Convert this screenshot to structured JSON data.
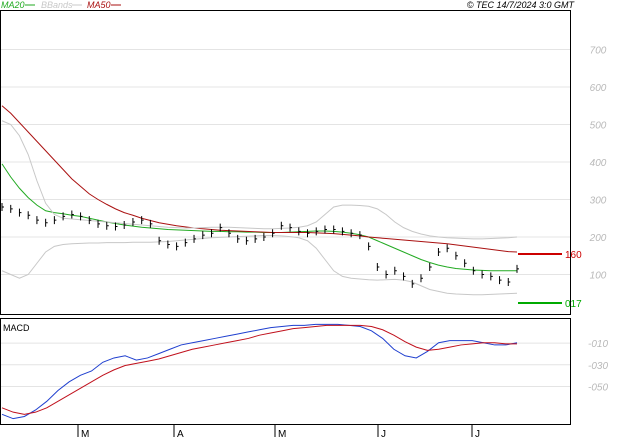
{
  "header": {
    "legend": [
      {
        "label": "MA20",
        "color": "#22aa22"
      },
      {
        "label": "BBands",
        "color": "#c8c8c8"
      },
      {
        "label": "MA50",
        "color": "#aa1111"
      }
    ],
    "copyright": "© TEC 14/7/2024 3:0 GMT"
  },
  "chart_data": [
    {
      "type": "line",
      "panel": "price",
      "title": "",
      "x_ticks": [
        "M",
        "A",
        "M",
        "J",
        "J"
      ],
      "yticks": [
        "700",
        "600",
        "500",
        "400",
        "300",
        "200",
        "100"
      ],
      "ylim": [
        0,
        800
      ],
      "grid": true,
      "y_side": "right",
      "markers": [
        {
          "label": "160",
          "value": 160,
          "color": "#cc0000"
        },
        {
          "label": "017",
          "value": 17,
          "color": "#00aa00"
        }
      ],
      "series": [
        {
          "name": "MA20",
          "color": "#22aa22",
          "values": [
            395,
            360,
            330,
            305,
            285,
            270,
            265,
            262,
            258,
            255,
            250,
            245,
            240,
            236,
            232,
            229,
            226,
            224,
            222,
            220,
            219,
            218,
            217,
            216,
            215,
            215,
            214,
            214,
            213,
            213,
            212,
            212,
            212,
            213,
            214,
            215,
            216,
            216,
            215,
            213,
            210,
            206,
            200,
            190,
            180,
            170,
            160,
            150,
            140,
            132,
            125,
            120,
            116,
            114,
            112,
            111,
            110,
            110,
            110,
            110
          ]
        },
        {
          "name": "MA50",
          "color": "#aa1111",
          "values": [
            550,
            530,
            505,
            480,
            455,
            430,
            405,
            380,
            355,
            335,
            315,
            300,
            287,
            275,
            265,
            258,
            250,
            244,
            238,
            234,
            230,
            227,
            224,
            222,
            220,
            218,
            217,
            216,
            215,
            214,
            213,
            212,
            212,
            212,
            212,
            212,
            211,
            210,
            209,
            207,
            205,
            203,
            200,
            198,
            196,
            194,
            192,
            190,
            188,
            186,
            184,
            182,
            179,
            176,
            173,
            170,
            167,
            164,
            161,
            160
          ]
        },
        {
          "name": "BBands upper",
          "color": "#c8c8c8",
          "values": [
            510,
            500,
            470,
            420,
            350,
            290,
            260,
            250,
            248,
            246,
            244,
            242,
            240,
            238,
            236,
            234,
            232,
            230,
            228,
            226,
            225,
            224,
            224,
            225,
            226,
            226,
            226,
            225,
            224,
            223,
            222,
            222,
            223,
            224,
            226,
            230,
            240,
            260,
            280,
            285,
            285,
            284,
            282,
            275,
            260,
            240,
            225,
            215,
            208,
            203,
            200,
            198,
            197,
            196,
            195,
            195,
            196,
            197,
            198,
            200
          ]
        },
        {
          "name": "BBands lower",
          "color": "#c8c8c8",
          "values": [
            110,
            100,
            90,
            100,
            130,
            160,
            175,
            180,
            182,
            183,
            184,
            184,
            185,
            185,
            185,
            186,
            186,
            186,
            187,
            188,
            190,
            192,
            194,
            196,
            198,
            199,
            200,
            201,
            202,
            203,
            204,
            204,
            203,
            201,
            198,
            190,
            170,
            140,
            110,
            95,
            90,
            88,
            86,
            85,
            86,
            87,
            85,
            80,
            70,
            60,
            55,
            50,
            48,
            47,
            46,
            46,
            47,
            48,
            49,
            50
          ]
        },
        {
          "name": "price",
          "color": "#000000",
          "values": [
            280,
            275,
            265,
            258,
            245,
            238,
            245,
            255,
            260,
            255,
            245,
            235,
            230,
            228,
            232,
            240,
            245,
            235,
            190,
            180,
            175,
            185,
            195,
            205,
            210,
            225,
            210,
            195,
            190,
            195,
            200,
            210,
            230,
            225,
            215,
            210,
            215,
            220,
            220,
            215,
            210,
            205,
            175,
            120,
            100,
            110,
            95,
            75,
            90,
            120,
            160,
            170,
            150,
            130,
            110,
            100,
            95,
            85,
            80,
            115
          ]
        }
      ]
    },
    {
      "type": "line",
      "panel": "macd",
      "title": "MACD",
      "yticks": [
        "-010",
        "-030",
        "-050"
      ],
      "grid": true,
      "y_side": "right",
      "series": [
        {
          "name": "MACD",
          "color": "#1f3fcf",
          "values": [
            -72,
            -76,
            -74,
            -68,
            -60,
            -50,
            -42,
            -36,
            -32,
            -24,
            -20,
            -18,
            -22,
            -20,
            -16,
            -12,
            -8,
            -6,
            -4,
            -2,
            0,
            2,
            4,
            6,
            8,
            9,
            10,
            10,
            11,
            11,
            11,
            10,
            9,
            5,
            -2,
            -12,
            -18,
            -20,
            -14,
            -6,
            -4,
            -4,
            -4,
            -6,
            -8,
            -8,
            -6
          ]
        },
        {
          "name": "Signal",
          "color": "#c0101c",
          "values": [
            -66,
            -70,
            -72,
            -70,
            -66,
            -60,
            -54,
            -48,
            -42,
            -36,
            -31,
            -27,
            -25,
            -23,
            -21,
            -18,
            -15,
            -12,
            -10,
            -8,
            -6,
            -4,
            -2,
            1,
            3,
            5,
            7,
            8,
            9,
            10,
            10,
            10,
            10,
            9,
            6,
            1,
            -5,
            -10,
            -13,
            -12,
            -10,
            -8,
            -7,
            -6,
            -6,
            -7,
            -7
          ]
        }
      ]
    }
  ]
}
